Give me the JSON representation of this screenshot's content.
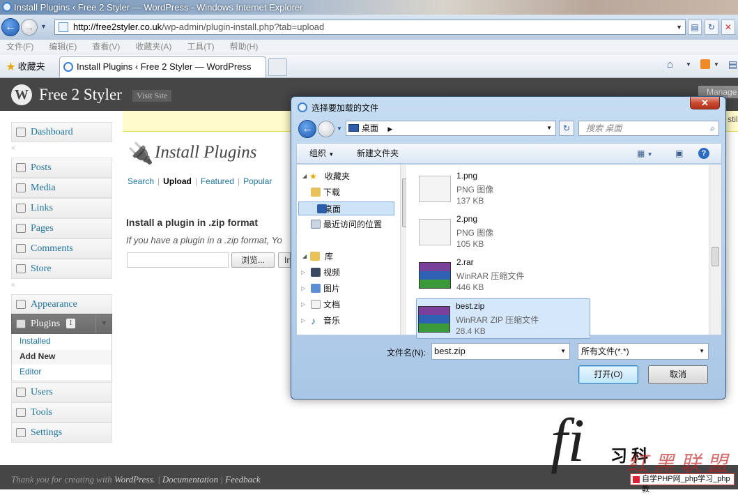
{
  "browser": {
    "window_title": "Install Plugins ‹ Free 2 Styler — WordPress - Windows Internet Explorer",
    "url_host": "http://free2styler.co.uk",
    "url_path": "/wp-admin/plugin-install.php?tab=upload",
    "menu": [
      "文件(F)",
      "编辑(E)",
      "查看(V)",
      "收藏夹(A)",
      "工具(T)",
      "帮助(H)"
    ],
    "favorites_label": "收藏夹",
    "tab_title": "Install Plugins ‹ Free 2 Styler — WordPress"
  },
  "wp": {
    "site_name": "Free 2 Styler",
    "visit_site": "Visit Site",
    "manage": "Manage",
    "nag": "still",
    "menu": {
      "dashboard": "Dashboard",
      "posts": "Posts",
      "media": "Media",
      "links": "Links",
      "pages": "Pages",
      "comments": "Comments",
      "store": "Store",
      "appearance": "Appearance",
      "plugins": "Plugins",
      "plugins_count": "1",
      "users": "Users",
      "tools": "Tools",
      "settings": "Settings"
    },
    "submenu": [
      "Installed",
      "Add New",
      "Editor"
    ],
    "page_title": "Install Plugins",
    "tabs": [
      "Search",
      "Upload",
      "Featured",
      "Popular"
    ],
    "heading": "Install a plugin in .zip format",
    "description": "If you have a plugin in a .zip format, Yo",
    "browse": "浏览...",
    "install_partial": "In",
    "footer": {
      "thanks": "Thank you for creating with",
      "wordpress": "WordPress.",
      "documentation": "Documentation",
      "feedback": "Feedback"
    }
  },
  "dialog": {
    "title": "选择要加载的文件",
    "path": "桌面",
    "search_placeholder": "搜索 桌面",
    "organize": "组织",
    "new_folder": "新建文件夹",
    "nav": {
      "favorites": "收藏夹",
      "downloads": "下载",
      "desktop": "桌面",
      "recent": "最近访问的位置",
      "library": "库",
      "videos": "视频",
      "pictures": "图片",
      "documents": "文档",
      "music": "音乐"
    },
    "files": [
      {
        "name": "1.png",
        "type": "PNG 图像",
        "size": "137 KB"
      },
      {
        "name": "2.png",
        "type": "PNG 图像",
        "size": "105 KB"
      },
      {
        "name": "2.rar",
        "type": "WinRAR 压缩文件",
        "size": "446 KB"
      },
      {
        "name": "best.zip",
        "type": "WinRAR ZIP 压缩文件",
        "size": "28.4 KB"
      }
    ],
    "filename_label": "文件名(N):",
    "filename_value": "best.zip",
    "filetype": "所有文件(*.*)",
    "open": "打开(O)",
    "cancel": "取消"
  },
  "watermark": {
    "cn": "习科",
    "red": "红黑联盟",
    "bar": "自学PHP网_php学习_php教"
  }
}
